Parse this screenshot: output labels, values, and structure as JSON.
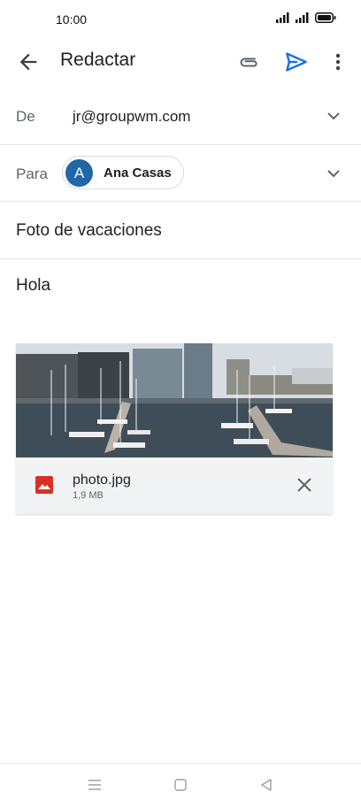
{
  "status": {
    "time": "10:00"
  },
  "app_bar": {
    "title": "Redactar"
  },
  "from": {
    "label": "De",
    "value": "jr@groupwm.com"
  },
  "to": {
    "label": "Para",
    "recipient_initial": "A",
    "recipient_name": "Ana Casas"
  },
  "subject": {
    "value": "Foto de vacaciones"
  },
  "body": {
    "text": "Hola"
  },
  "attachment": {
    "file_name": "photo.jpg",
    "file_size": "1,9 MB"
  },
  "colors": {
    "accent": "#1a73e8",
    "avatar": "#1f67a7",
    "file_icon": "#d93025"
  }
}
